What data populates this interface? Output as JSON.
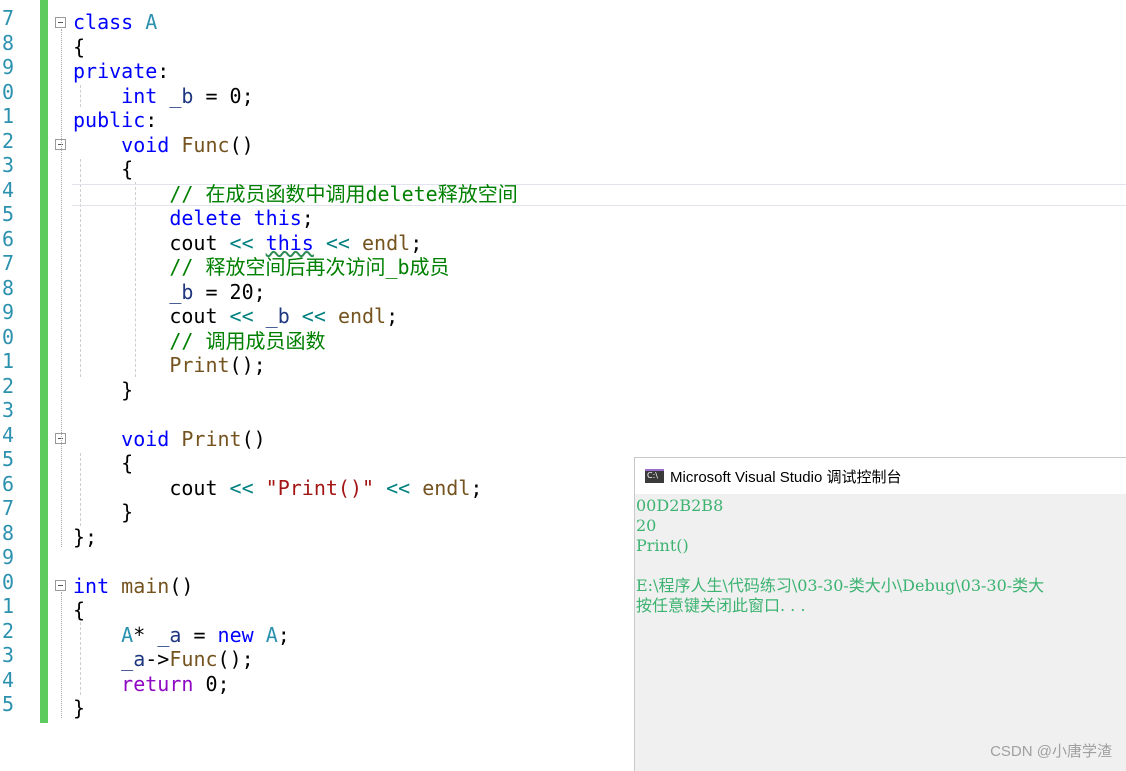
{
  "editor": {
    "line_numbers": [
      "7",
      "8",
      "9",
      "0",
      "1",
      "2",
      "3",
      "4",
      "5",
      "6",
      "7",
      "8",
      "9",
      "0",
      "1",
      "2",
      "3",
      "4",
      "5",
      "6",
      "7",
      "8",
      "9",
      "0",
      "1",
      "2",
      "3",
      "4",
      "5"
    ],
    "lines": [
      {
        "kw": "class",
        "ty": "A"
      },
      {
        "t": "{"
      },
      {
        "kw": "private",
        "t": ":"
      },
      {
        "kw": "int",
        "var": "_b",
        "t": " = 0;"
      },
      {
        "kw": "public",
        "t": ":"
      },
      {
        "kw": "void",
        "fn": "Func",
        "t": "()"
      },
      {
        "t": "{"
      },
      {
        "comment": "// 在成员函数中调用delete释放空间"
      },
      {
        "kw": "delete",
        "kw2": "this",
        "t": ";"
      },
      {
        "a": "cout",
        "op": "<<",
        "kw": "this",
        "op2": "<<",
        "fn": "endl",
        "t": ";"
      },
      {
        "comment": "// 释放空间后再次访问_b成员"
      },
      {
        "var": "_b",
        "t": " = 20;"
      },
      {
        "a": "cout",
        "op": "<<",
        "var": "_b",
        "op2": "<<",
        "fn": "endl",
        "t": ";"
      },
      {
        "comment": "// 调用成员函数"
      },
      {
        "fn": "Print",
        "t": "();"
      },
      {
        "t": "}"
      },
      {
        "t": ""
      },
      {
        "kw": "void",
        "fn": "Print",
        "t": "()"
      },
      {
        "t": "{"
      },
      {
        "a": "cout",
        "op": "<<",
        "str": "\"Print()\"",
        "op2": "<<",
        "fn": "endl",
        "t": ";"
      },
      {
        "t": "}"
      },
      {
        "t": "};"
      },
      {
        "t": ""
      },
      {
        "kw": "int",
        "fn": "main",
        "t": "()"
      },
      {
        "t": "{"
      },
      {
        "ty": "A",
        "t": "* ",
        "var": "_a",
        "t2": " = ",
        "kw": "new",
        "ty2": "A",
        "t3": ";"
      },
      {
        "var": "_a",
        "t": "->",
        "fn": "Func",
        "t2": "();"
      },
      {
        "kw": "return",
        "t": " 0;"
      },
      {
        "t": "}"
      }
    ]
  },
  "console": {
    "title": "Microsoft Visual Studio 调试控制台",
    "icon": "console-app-icon",
    "icon_text": "C:\\",
    "output": [
      "00D2B2B8",
      "20",
      "Print()",
      "",
      "E:\\程序人生\\代码练习\\03-30-类大小\\Debug\\03-30-类大",
      "按任意键关闭此窗口. . ."
    ]
  },
  "watermark": "CSDN @小唐学渣",
  "colors": {
    "keyword": "#0000ff",
    "type": "#2b91af",
    "function": "#74531f",
    "comment": "#008000",
    "string": "#a31515",
    "operator": "#008080",
    "console_text": "#3cb371",
    "change_bar": "#5ecb5e"
  }
}
